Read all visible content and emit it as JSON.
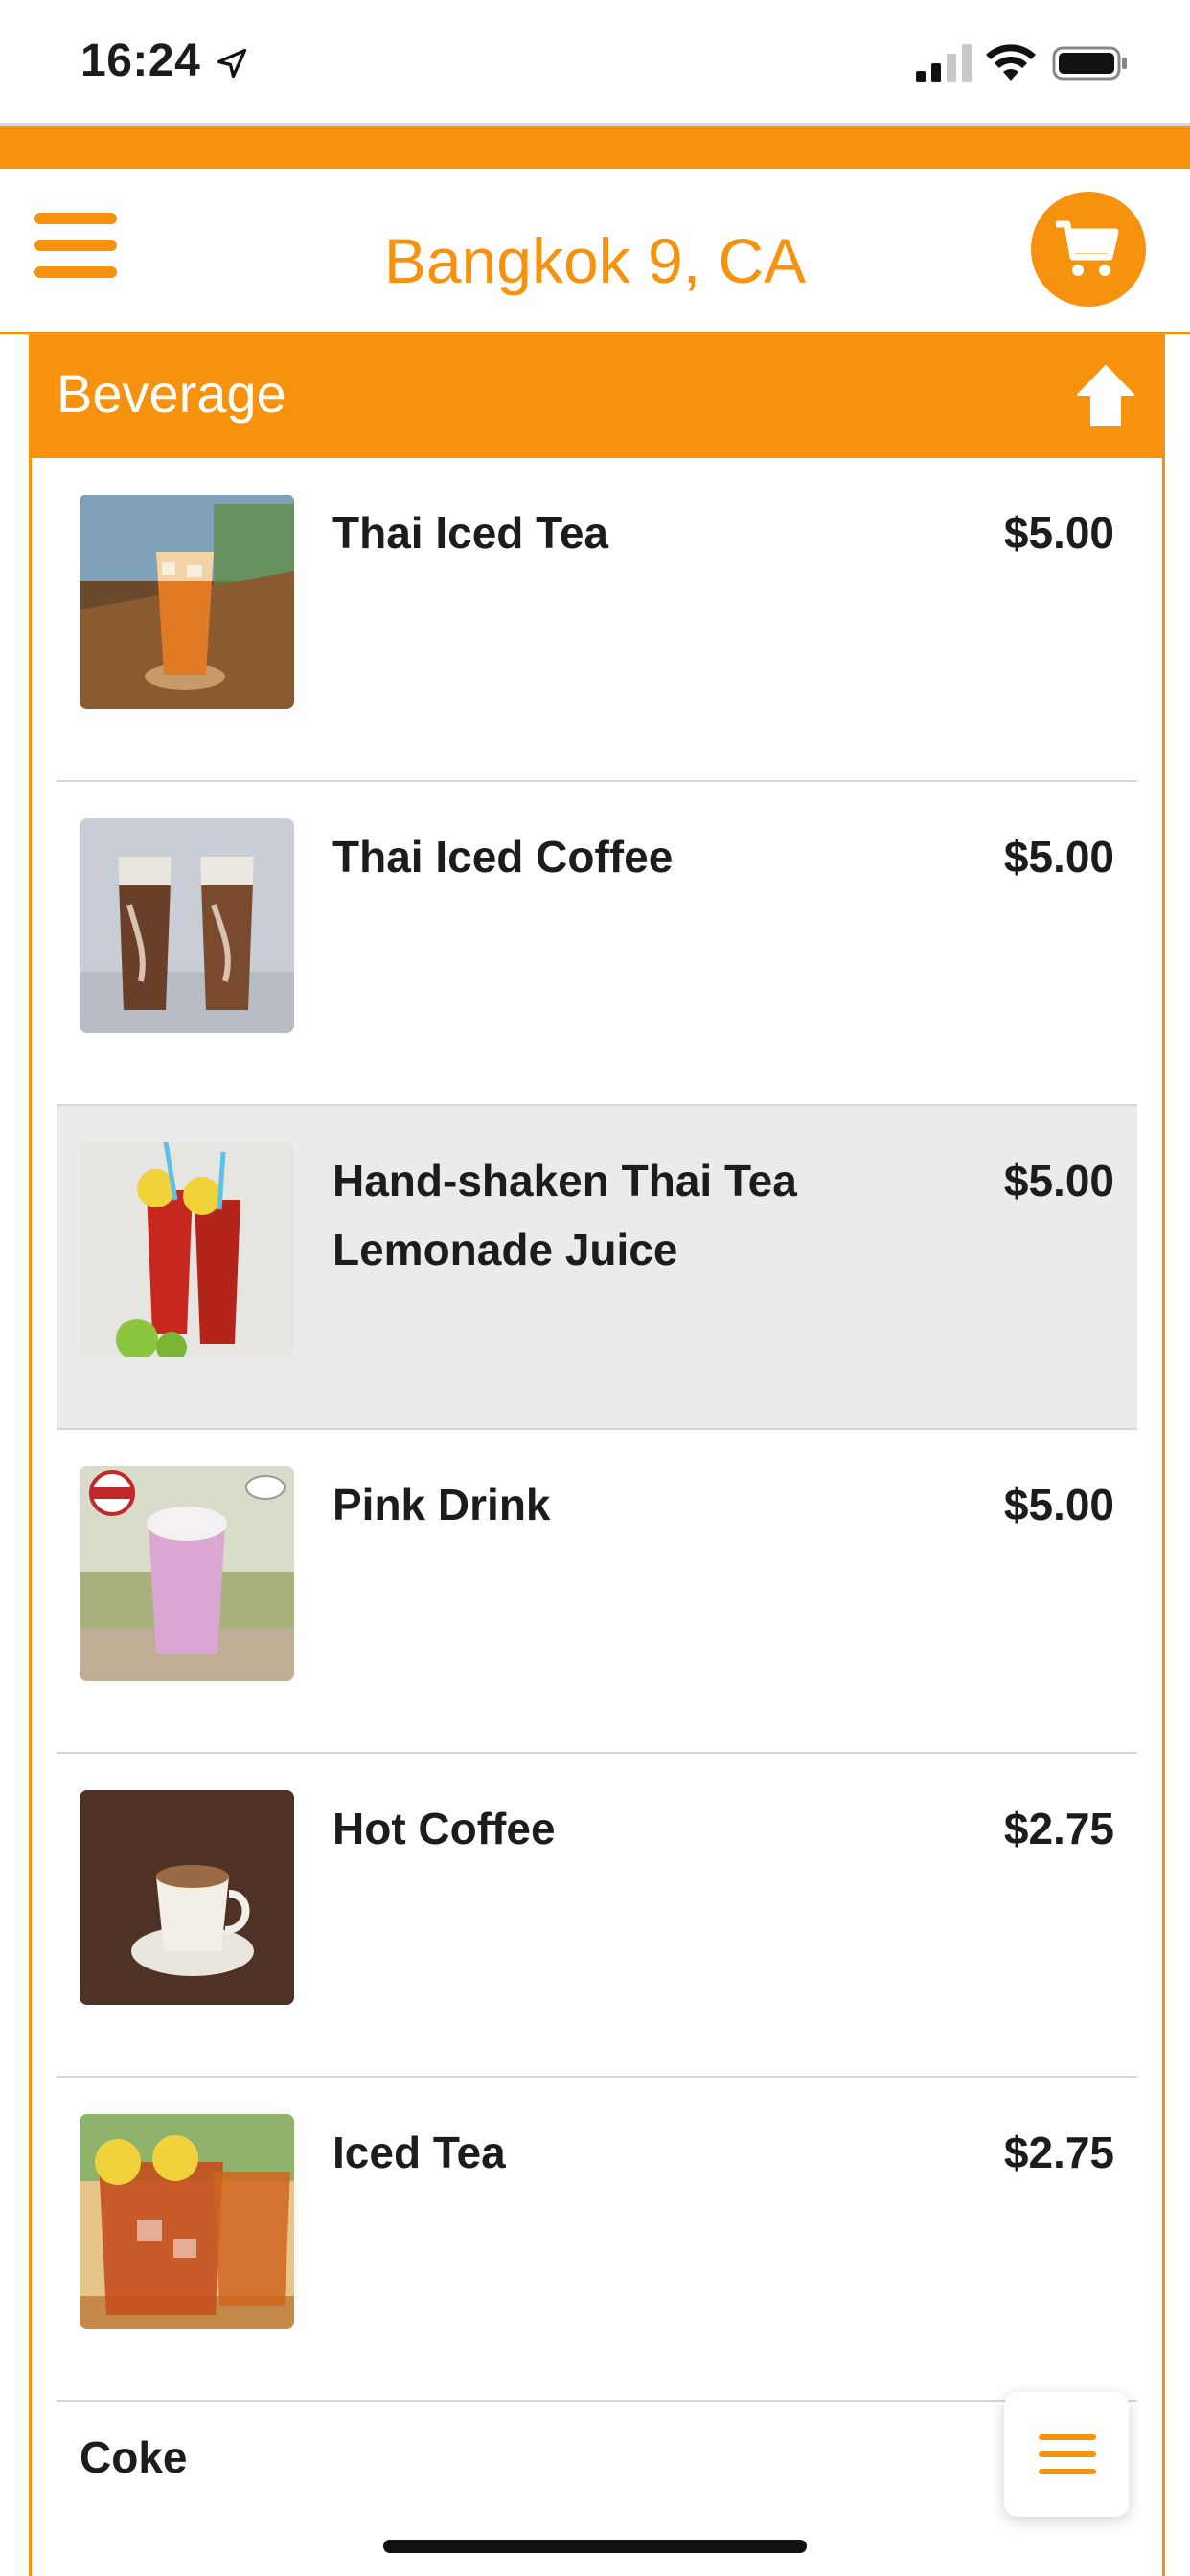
{
  "status_bar": {
    "time": "16:24"
  },
  "header": {
    "store_name": "Bangkok 9, CA",
    "accent_color": "#F7920F"
  },
  "category": {
    "title": "Beverage",
    "items": [
      {
        "name": "Thai Iced Tea",
        "price": "$5.00"
      },
      {
        "name": "Thai Iced Coffee",
        "price": "$5.00"
      },
      {
        "name": "Hand-shaken Thai Tea Lemonade Juice",
        "price": "$5.00"
      },
      {
        "name": "Pink Drink",
        "price": "$5.00"
      },
      {
        "name": "Hot Coffee",
        "price": "$2.75"
      },
      {
        "name": "Iced Tea",
        "price": "$2.75"
      },
      {
        "name": "Coke",
        "price": "$"
      }
    ]
  },
  "icons": {
    "menu": "hamburger-icon",
    "cart": "cart-icon",
    "collapse": "arrow-up-icon",
    "floating_menu": "list-icon"
  }
}
